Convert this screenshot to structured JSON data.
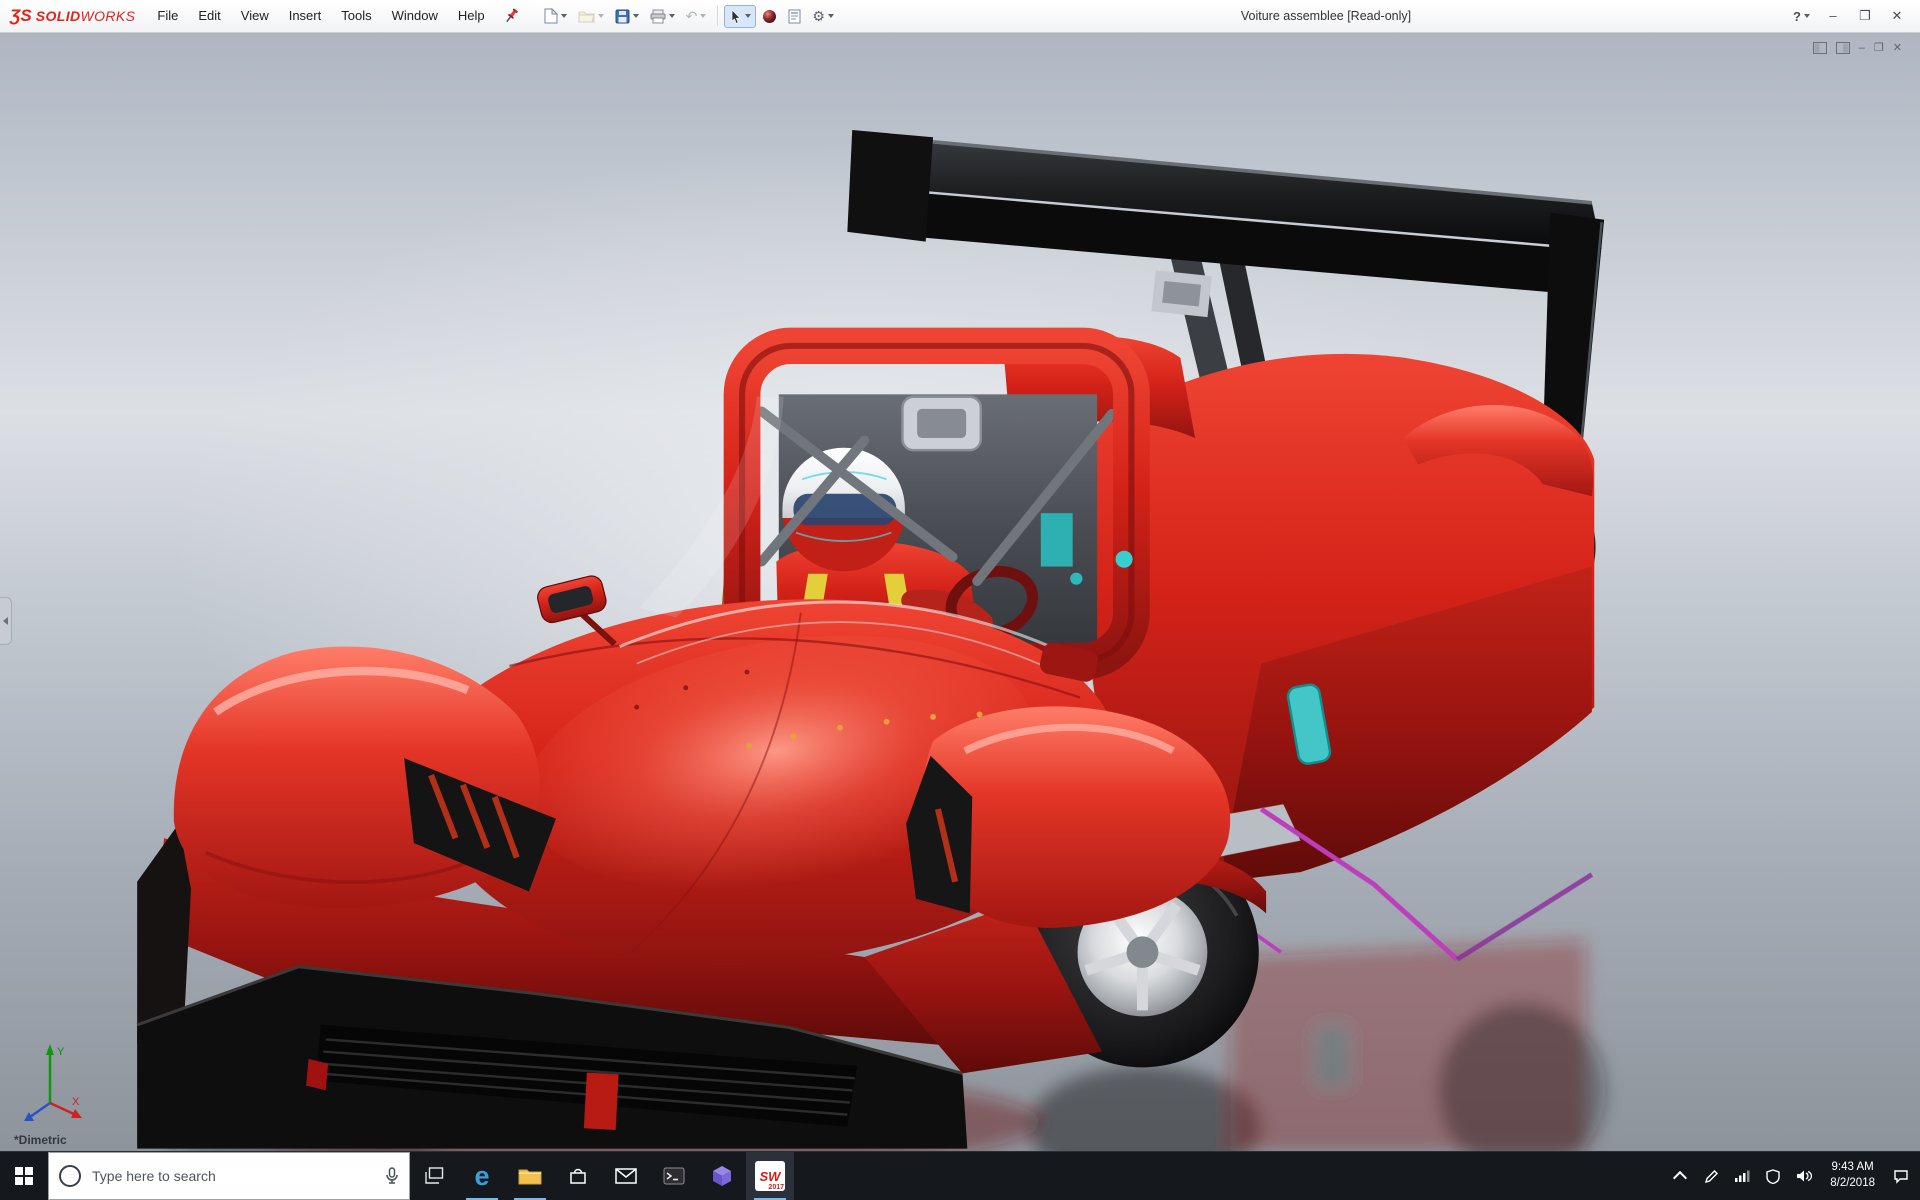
{
  "app": {
    "logo_mark": "ƷS",
    "logo_solid": "SOLID",
    "logo_works": "WORKS",
    "title": "Voiture assemblee [Read-only]",
    "help_label": "?"
  },
  "menubar": {
    "items": [
      "File",
      "Edit",
      "View",
      "Insert",
      "Tools",
      "Window",
      "Help"
    ]
  },
  "toolbar": {
    "icon_names": [
      "pin-icon",
      "new-document-icon",
      "open-icon",
      "save-icon",
      "print-icon",
      "undo-icon",
      "select-cursor-icon",
      "appearance-sphere-icon",
      "document-properties-icon",
      "options-gear-icon"
    ],
    "undo_glyph": "↶",
    "gear_glyph": "⚙"
  },
  "window_controls": {
    "minimize": "–",
    "maximize": "❐",
    "close": "✕"
  },
  "child_window": {
    "icon_names": [
      "pane-left-icon",
      "pane-right-icon",
      "minimize-icon",
      "restore-icon",
      "close-icon"
    ]
  },
  "viewport": {
    "view_label": "*Dimetric",
    "triad": {
      "x": "X",
      "y": "Y"
    },
    "model_colors": {
      "body_red": "#d42218",
      "wing_black": "#0b0b0b",
      "accent_teal": "#35cfcf",
      "accent_magenta": "#bc3ebc",
      "helmet_white": "#f4f5f6",
      "background_top": "#aeb6c2",
      "background_bottom": "#8e949c"
    }
  },
  "taskbar": {
    "search_placeholder": "Type here to search",
    "edge_glyph": "e",
    "sw_label": "SW",
    "sw_badge": "2017",
    "clock": {
      "time": "9:43 AM",
      "date": "8/2/2018"
    },
    "icon_names": [
      "start-button",
      "cortana-icon",
      "mic-icon",
      "task-view-icon",
      "edge-icon",
      "file-explorer-icon",
      "store-icon",
      "mail-icon",
      "console-icon",
      "cube-app-icon",
      "solidworks-icon",
      "tray-chevron-icon",
      "pen-icon",
      "network-icon",
      "volume-icon",
      "shield-icon",
      "action-center-icon"
    ]
  }
}
